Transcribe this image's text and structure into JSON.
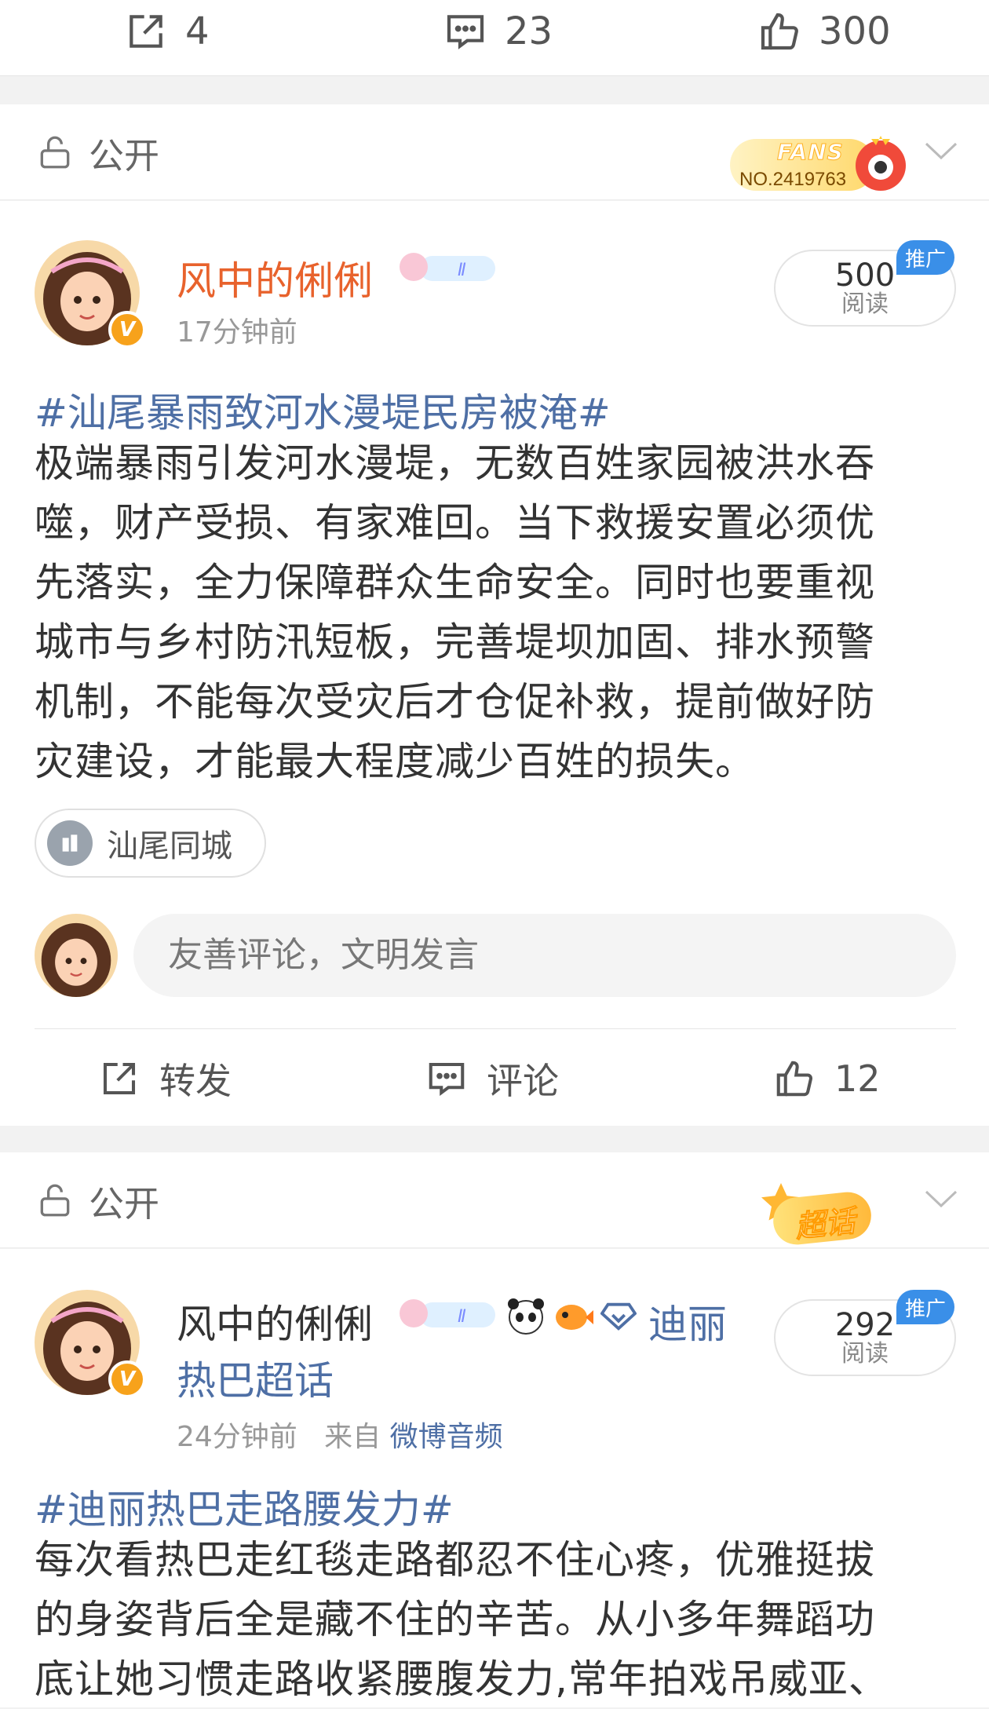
{
  "top_actions": {
    "repost_count": "4",
    "comment_count": "23",
    "like_count": "300"
  },
  "post1": {
    "visibility": "公开",
    "fans_badge": {
      "title": "FANS",
      "number": "NO.2419763"
    },
    "username": "风中的俐俐",
    "username_color": "#e8622c",
    "level_badge": "Ⅱ",
    "time": "17分钟前",
    "read": {
      "count": "500",
      "label": "阅读",
      "ad": "推广"
    },
    "topic": "#汕尾暴雨致河水漫堤民房被淹#",
    "body_lines": [
      "极端暴雨引发河水漫堤，无数百姓家园被洪水吞",
      "噬，财产受损、有家难回。当下救援安置必须优",
      "先落实，全力保障群众生命安全。同时也要重视",
      "城市与乡村防汛短板，完善堤坝加固、排水预警",
      "机制，不能每次受灾后才仓促补救，提前做好防",
      "灾建设，才能最大程度减少百姓的损失。"
    ],
    "location": "汕尾同城",
    "comment_placeholder": "友善评论，文明发言",
    "actions": {
      "repost": "转发",
      "comment": "评论",
      "like": "12"
    }
  },
  "post2": {
    "visibility": "公开",
    "chaohua_badge": "超话",
    "username": "风中的俐俐",
    "level_badge": "Ⅱ",
    "supertopic_line1": "迪丽",
    "supertopic_line2": "热巴超话",
    "time": "24分钟前",
    "source_prefix": "来自",
    "source": "微博音频",
    "read": {
      "count": "292",
      "label": "阅读",
      "ad": "推广"
    },
    "topic": "#迪丽热巴走路腰发力#",
    "body_lines": [
      "每次看热巴走红毯走路都忍不住心疼，优雅挺拔",
      "的身姿背后全是藏不住的辛苦。从小多年舞蹈功",
      "底让她习惯走路收紧腰腹发力,常年拍戏吊威亚、"
    ]
  },
  "colors": {
    "link": "#4e6fa5",
    "ad_blue": "#3a8fe8",
    "vip_orange": "#f7a21b"
  }
}
